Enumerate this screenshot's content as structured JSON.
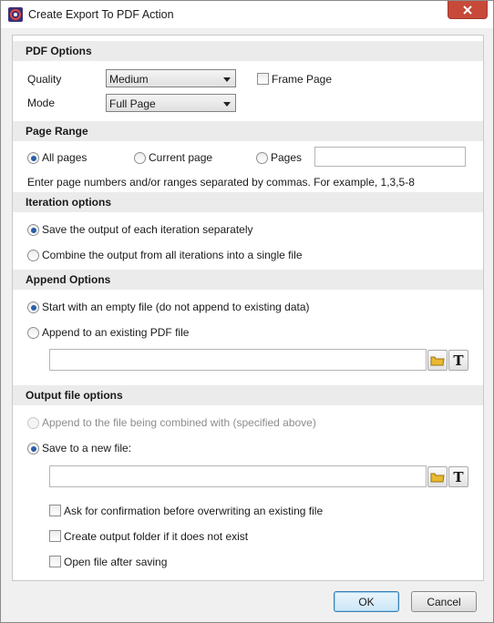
{
  "window": {
    "title": "Create Export To PDF Action"
  },
  "pdf_options": {
    "header": "PDF Options",
    "quality_label": "Quality",
    "quality_value": "Medium",
    "mode_label": "Mode",
    "mode_value": "Full Page",
    "frame_page_label": "Frame Page",
    "frame_page_checked": false
  },
  "page_range": {
    "header": "Page Range",
    "all_pages_label": "All pages",
    "current_page_label": "Current page",
    "pages_label": "Pages",
    "selected": "All pages",
    "pages_value": "",
    "hint": "Enter page numbers and/or ranges separated by commas. For example, 1,3,5-8"
  },
  "iteration_options": {
    "header": "Iteration options",
    "separate_label": "Save the output of each iteration separately",
    "combine_label": "Combine the output from all iterations into a single file",
    "selected": "Save the output of each iteration separately"
  },
  "append_options": {
    "header": "Append Options",
    "empty_file_label": "Start with an empty file (do not append to existing data)",
    "existing_file_label": "Append to an existing PDF file",
    "selected": "Start with an empty file (do not append to existing data)",
    "file_path": ""
  },
  "output_file_options": {
    "header": "Output file options",
    "append_combined_label": "Append to the file being combined with (specified above)",
    "save_new_label": "Save to a new file:",
    "selected": "Save to a new file:",
    "file_path": "",
    "ask_confirm_label": "Ask for confirmation before overwriting an existing file",
    "create_folder_label": "Create output folder if it does not exist",
    "open_after_label": "Open file after saving",
    "ask_confirm_checked": false,
    "create_folder_checked": false,
    "open_after_checked": false
  },
  "footer": {
    "ok_label": "OK",
    "cancel_label": "Cancel"
  },
  "colors": {
    "accent": "#2a5ea8",
    "close": "#c7493a",
    "section_bg": "#ebebeb",
    "folder": "#e8b931"
  }
}
